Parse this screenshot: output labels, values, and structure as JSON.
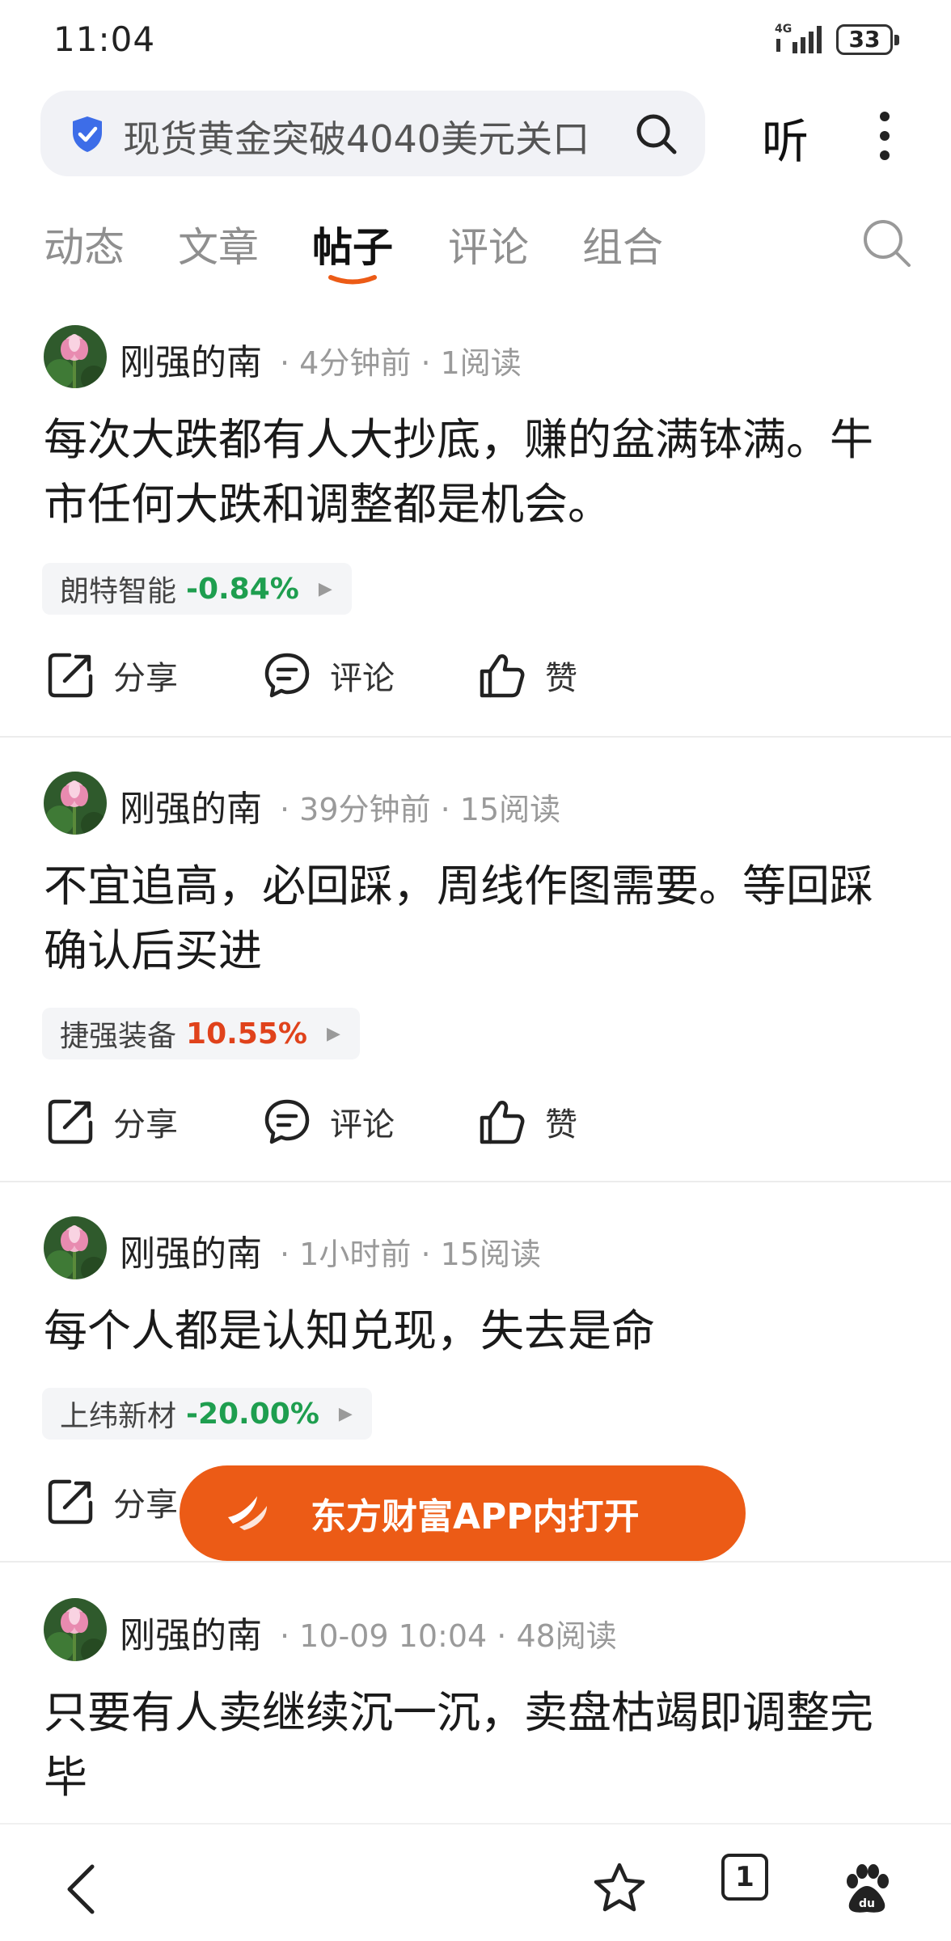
{
  "status_bar": {
    "time": "11:04",
    "network": "4G",
    "battery": "33"
  },
  "search": {
    "query": "现货黄金突破4040美元关口"
  },
  "header": {
    "listen_label": "听"
  },
  "tabs": [
    {
      "label": "动态"
    },
    {
      "label": "文章"
    },
    {
      "label": "帖子"
    },
    {
      "label": "评论"
    },
    {
      "label": "组合"
    }
  ],
  "active_tab": "帖子",
  "colors": {
    "accent": "#ec5b16",
    "down": "#1e9e4f",
    "up": "#e0421b"
  },
  "posts": [
    {
      "author": "刚强的南",
      "time": "4分钟前",
      "reads": "1阅读",
      "text": "每次大跌都有人大抄底，赚的盆满钵满。牛市任何大跌和调整都是机会。",
      "stock": {
        "name": "朗特智能",
        "change": "-0.84%",
        "direction": "down"
      },
      "actions": {
        "share": "分享",
        "comment": "评论",
        "like": "赞"
      }
    },
    {
      "author": "刚强的南",
      "time": "39分钟前",
      "reads": "15阅读",
      "text": "不宜追高，必回踩，周线作图需要。等回踩确认后买进",
      "stock": {
        "name": "捷强装备",
        "change": "10.55%",
        "direction": "up"
      },
      "actions": {
        "share": "分享",
        "comment": "评论",
        "like": "赞"
      }
    },
    {
      "author": "刚强的南",
      "time": "1小时前",
      "reads": "15阅读",
      "text": "每个人都是认知兑现，失去是命",
      "stock": {
        "name": "上纬新材",
        "change": "-20.00%",
        "direction": "down"
      },
      "actions": {
        "share": "分享"
      }
    },
    {
      "author": "刚强的南",
      "time": "10-09 10:04",
      "reads": "48阅读",
      "text": "只要有人卖继续沉一沉，卖盘枯竭即调整完毕"
    }
  ],
  "open_app_label": "东方财富APP内打开",
  "bottom_nav": {
    "tabs_count": "1"
  }
}
